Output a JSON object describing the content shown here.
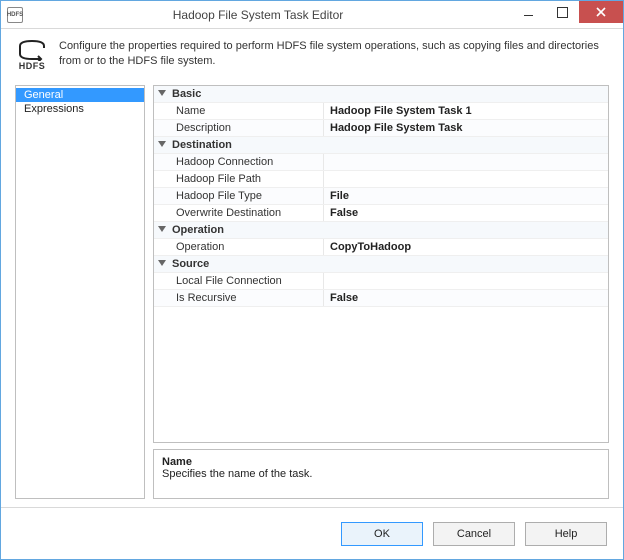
{
  "window": {
    "title": "Hadoop File System Task Editor",
    "icon_label": "HDFS"
  },
  "header": {
    "logo_label": "HDFS",
    "description": "Configure the properties required to perform HDFS file system operations, such as copying files and directories from or to the HDFS file system."
  },
  "nav": {
    "items": [
      {
        "label": "General",
        "selected": true
      },
      {
        "label": "Expressions",
        "selected": false
      }
    ]
  },
  "grid": {
    "categories": [
      {
        "name": "Basic",
        "rows": [
          {
            "label": "Name",
            "value": "Hadoop File System Task 1"
          },
          {
            "label": "Description",
            "value": "Hadoop File System Task"
          }
        ]
      },
      {
        "name": "Destination",
        "rows": [
          {
            "label": "Hadoop Connection",
            "value": ""
          },
          {
            "label": "Hadoop File Path",
            "value": ""
          },
          {
            "label": "Hadoop File Type",
            "value": "File"
          },
          {
            "label": "Overwrite Destination",
            "value": "False"
          }
        ]
      },
      {
        "name": "Operation",
        "rows": [
          {
            "label": "Operation",
            "value": "CopyToHadoop"
          }
        ]
      },
      {
        "name": "Source",
        "rows": [
          {
            "label": "Local File Connection",
            "value": ""
          },
          {
            "label": "Is Recursive",
            "value": "False"
          }
        ]
      }
    ]
  },
  "helpbox": {
    "title": "Name",
    "description": "Specifies the name of the task."
  },
  "footer": {
    "ok": "OK",
    "cancel": "Cancel",
    "help": "Help"
  }
}
